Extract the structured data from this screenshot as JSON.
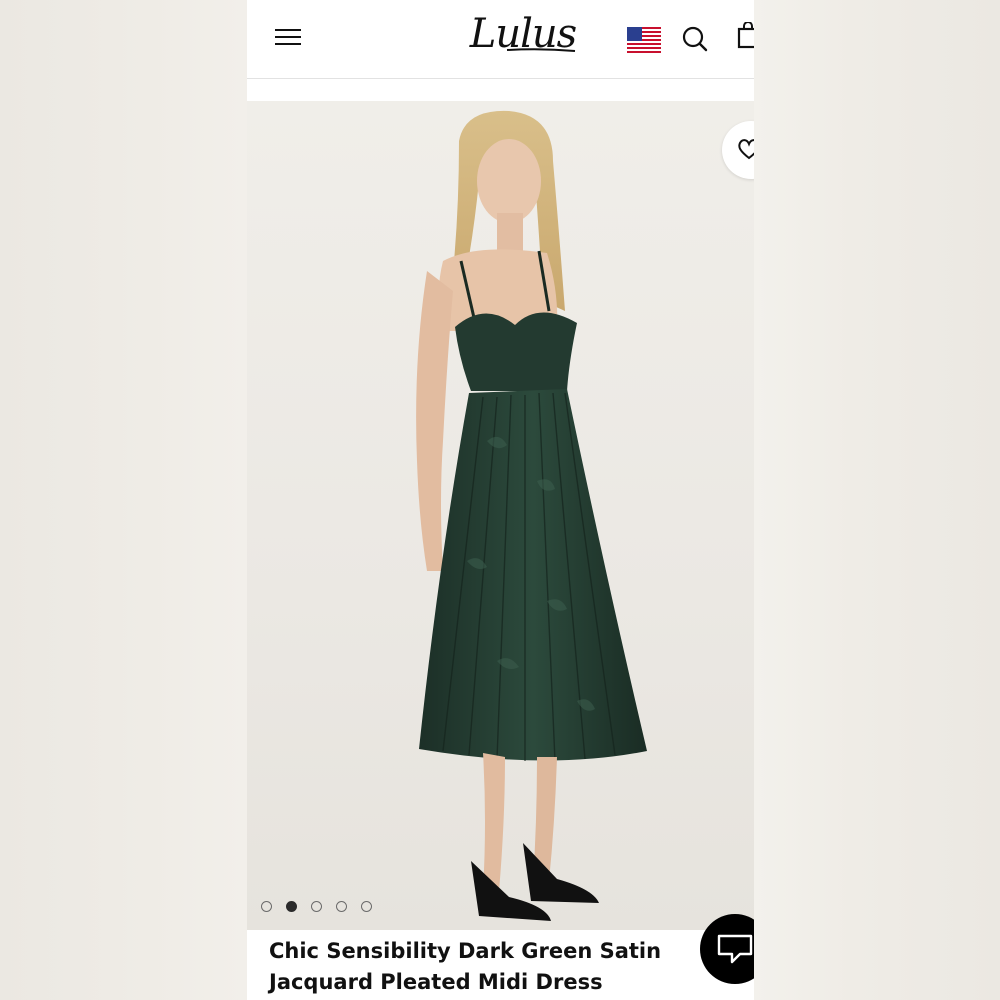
{
  "header": {
    "logo_text": "Lulus",
    "menu_icon": "hamburger-menu-icon",
    "flag_icon": "us-flag-icon",
    "search_icon": "search-icon",
    "bag_icon": "shopping-bag-icon"
  },
  "product": {
    "title": "Chic Sensibility Dark Green Satin Jacquard Pleated Midi Dress",
    "dress_color": "#233a30",
    "wishlist_icon": "heart-icon",
    "gallery": {
      "total": 5,
      "active_index": 1
    }
  },
  "chat": {
    "icon": "chat-bubble-icon"
  },
  "colors": {
    "text": "#111111",
    "chat_bg": "#000000",
    "hero_bg": "#ece9e3"
  }
}
